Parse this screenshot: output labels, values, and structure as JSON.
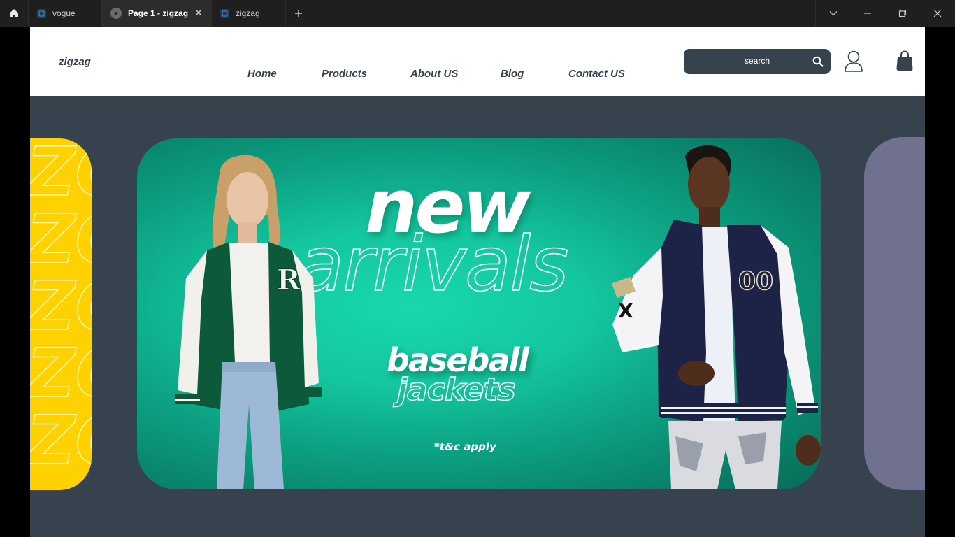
{
  "browser": {
    "tabs": [
      {
        "label": "vogue",
        "active": false
      },
      {
        "label": "Page 1 - zigzag",
        "active": true
      },
      {
        "label": "zigzag",
        "active": false
      }
    ]
  },
  "header": {
    "logo": "zigzag",
    "nav": [
      "Home",
      "Products",
      "About US",
      "Blog",
      "Contact US"
    ],
    "search_placeholder": "search"
  },
  "hero": {
    "headline": "new",
    "headline_outline": "arrivals",
    "product": "baseball",
    "product_outline": "jackets",
    "terms": "*t&c apply",
    "side_left_watermark": "ZO",
    "colors": {
      "main_banner": "#14c79f",
      "left_banner": "#fdd200",
      "right_banner": "#70708f",
      "background": "#36434f"
    }
  }
}
